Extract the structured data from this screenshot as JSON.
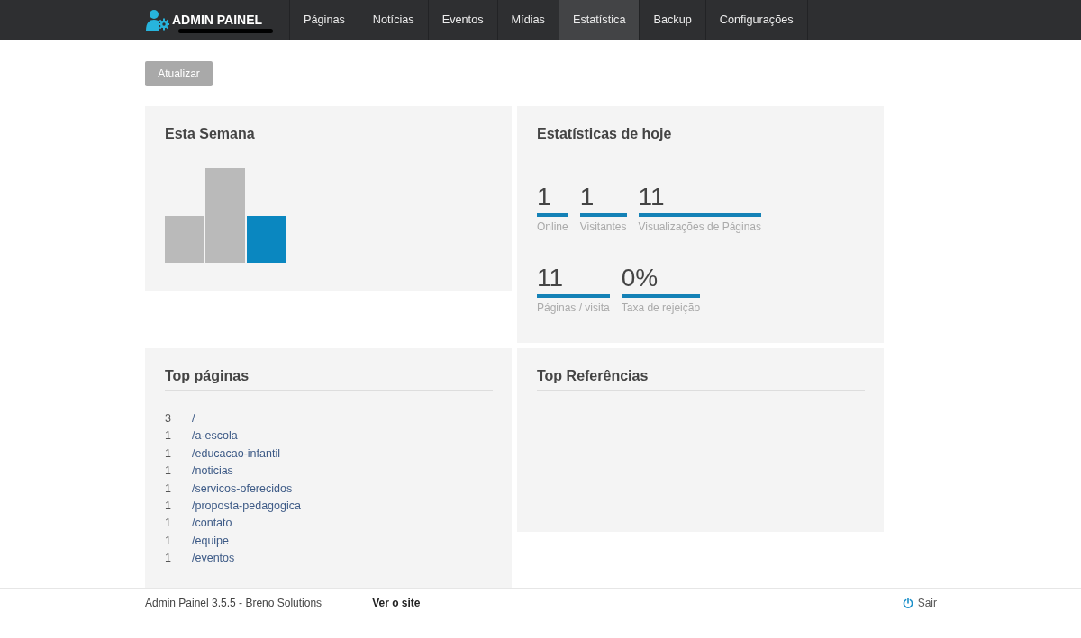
{
  "navbar": {
    "logo_text": "ADMIN PAINEL",
    "items": [
      {
        "label": "Páginas",
        "selected": false
      },
      {
        "label": "Notícias",
        "selected": false
      },
      {
        "label": "Eventos",
        "selected": false
      },
      {
        "label": "Mídias",
        "selected": false
      },
      {
        "label": "Estatística",
        "selected": true
      },
      {
        "label": "Backup",
        "selected": false
      },
      {
        "label": "Configurações",
        "selected": false
      }
    ]
  },
  "toolbar": {
    "refresh_button": "Atualizar"
  },
  "week_panel": {
    "title": "Esta Semana"
  },
  "today_panel": {
    "title": "Estatísticas de hoje",
    "stats": [
      {
        "value": "1",
        "label": "Online"
      },
      {
        "value": "1",
        "label": "Visitantes"
      },
      {
        "value": "11",
        "label": "Visualizações de Páginas"
      },
      {
        "value": "11",
        "label": "Páginas / visita"
      },
      {
        "value": "0%",
        "label": "Taxa de rejeição"
      }
    ]
  },
  "top_pages_panel": {
    "title": "Top páginas",
    "rows": [
      {
        "count": "3",
        "path": "/"
      },
      {
        "count": "1",
        "path": "/a-escola"
      },
      {
        "count": "1",
        "path": "/educacao-infantil"
      },
      {
        "count": "1",
        "path": "/noticias"
      },
      {
        "count": "1",
        "path": "/servicos-oferecidos"
      },
      {
        "count": "1",
        "path": "/proposta-pedagogica"
      },
      {
        "count": "1",
        "path": "/contato"
      },
      {
        "count": "1",
        "path": "/equipe"
      },
      {
        "count": "1",
        "path": "/eventos"
      }
    ]
  },
  "top_referrers_panel": {
    "title": "Top Referências"
  },
  "footer": {
    "credit": "Admin Painel 3.5.5 - Breno Solutions",
    "site_link": "Ver o site",
    "logout": "Sair"
  }
}
